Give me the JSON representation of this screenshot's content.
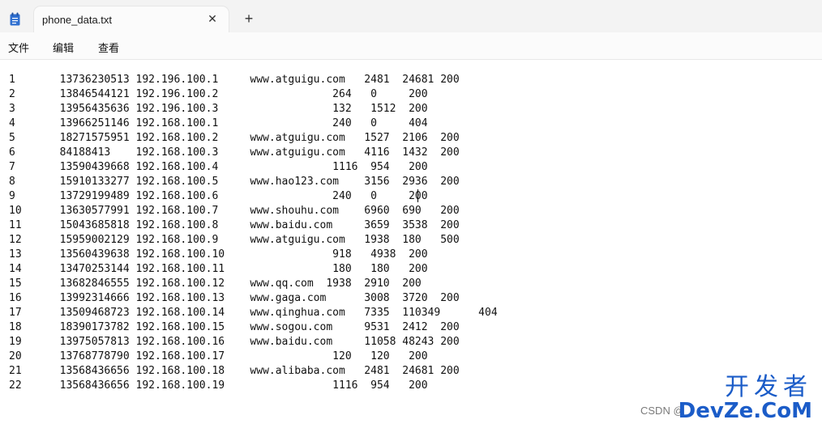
{
  "tab": {
    "title": "phone_data.txt",
    "close": "✕",
    "new": "+"
  },
  "menu": [
    {
      "label": "文件"
    },
    {
      "label": "编辑"
    },
    {
      "label": "查看"
    }
  ],
  "editor": {
    "lines": [
      "1       13736230513 192.196.100.1     www.atguigu.com   2481  24681 200",
      "2       13846544121 192.196.100.2                  264   0     200",
      "3       13956435636 192.196.100.3                  132   1512  200",
      "4       13966251146 192.168.100.1                  240   0     404",
      "5       18271575951 192.168.100.2     www.atguigu.com   1527  2106  200",
      "6       84188413    192.168.100.3     www.atguigu.com   4116  1432  200",
      "7       13590439668 192.168.100.4                  1116  954   200",
      "8       15910133277 192.168.100.5     www.hao123.com    3156  2936  200",
      "9       13729199489 192.168.100.6                  240   0     200",
      "10      13630577991 192.168.100.7     www.shouhu.com    6960  690   200",
      "11      15043685818 192.168.100.8     www.baidu.com     3659  3538  200",
      "12      15959002129 192.168.100.9     www.atguigu.com   1938  180   500",
      "13      13560439638 192.168.100.10                 918   4938  200",
      "14      13470253144 192.168.100.11                 180   180   200",
      "15      13682846555 192.168.100.12    www.qq.com  1938  2910  200",
      "16      13992314666 192.168.100.13    www.gaga.com      3008  3720  200",
      "17      13509468723 192.168.100.14    www.qinghua.com   7335  110349      404",
      "18      18390173782 192.168.100.15    www.sogou.com     9531  2412  200",
      "19      13975057813 192.168.100.16    www.baidu.com     11058 48243 200",
      "20      13768778790 192.168.100.17                 120   120   200",
      "21      13568436656 192.168.100.18    www.alibaba.com   2481  24681 200",
      "22      13568436656 192.168.100.19                 1116  954   200"
    ]
  },
  "watermark": {
    "cn": "开发者",
    "en": "DevZe.CoM",
    "csdn": "CSDN @"
  }
}
